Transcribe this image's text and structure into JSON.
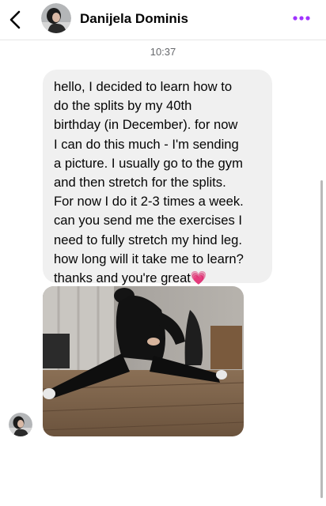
{
  "header": {
    "contact_name": "Danijela Dominis",
    "back_icon": "chevron-left-icon",
    "more_icon": "more-dots-icon",
    "accent_color": "#a033ff"
  },
  "conversation": {
    "timestamp": "10:37",
    "message_text": "hello, I decided to learn how to\ndo the splits by my 40th\nbirthday (in December). for now\nI can do this much - I'm sending\na picture. I usually go to the gym\nand then stretch for the splits.\nFor now I do it 2-3 times a week.\ncan you send me the exercises I\nneed to fully stretch my hind leg.\nhow long will it take me to learn?\nthanks and you're great",
    "message_emoji": "💗",
    "attachment": "photo"
  }
}
